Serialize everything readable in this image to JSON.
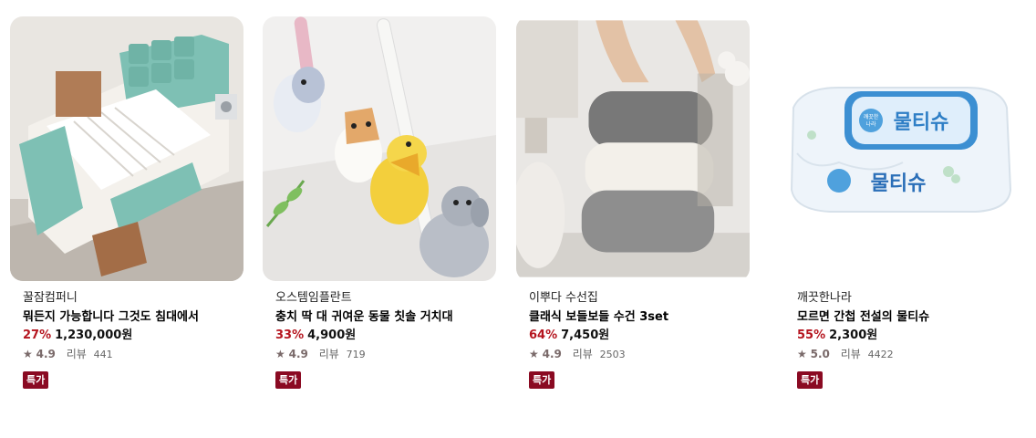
{
  "products": [
    {
      "brand": "꿀잠컴퍼니",
      "title": "뭐든지 가능합니다 그것도 침대에서",
      "discount": "27%",
      "price": "1,230,000원",
      "star": "★",
      "rating": "4.9",
      "review_label": "리뷰",
      "review_count": "441",
      "badge": "특가"
    },
    {
      "brand": "오스템임플란트",
      "title": "충치 딱 대 귀여운 동물 칫솔 거치대",
      "discount": "33%",
      "price": "4,900원",
      "star": "★",
      "rating": "4.9",
      "review_label": "리뷰",
      "review_count": "719",
      "badge": "특가"
    },
    {
      "brand": "이뿌다 수선집",
      "title": "클래식 보들보들 수건 3set",
      "discount": "64%",
      "price": "7,450원",
      "star": "★",
      "rating": "4.9",
      "review_label": "리뷰",
      "review_count": "2503",
      "badge": "특가"
    },
    {
      "brand": "깨끗한나라",
      "title": "모르면 간첩 전설의 물티슈",
      "discount": "55%",
      "price": "2,300원",
      "star": "★",
      "rating": "5.0",
      "review_label": "리뷰",
      "review_count": "4422",
      "badge": "특가"
    }
  ],
  "wipes_packaging": {
    "line1": "깨끗한",
    "line2": "나라",
    "product": "물티슈"
  },
  "colors": {
    "discount": "#b5151f",
    "badge_bg": "#8a0a22",
    "star": "#7a6a6a"
  }
}
